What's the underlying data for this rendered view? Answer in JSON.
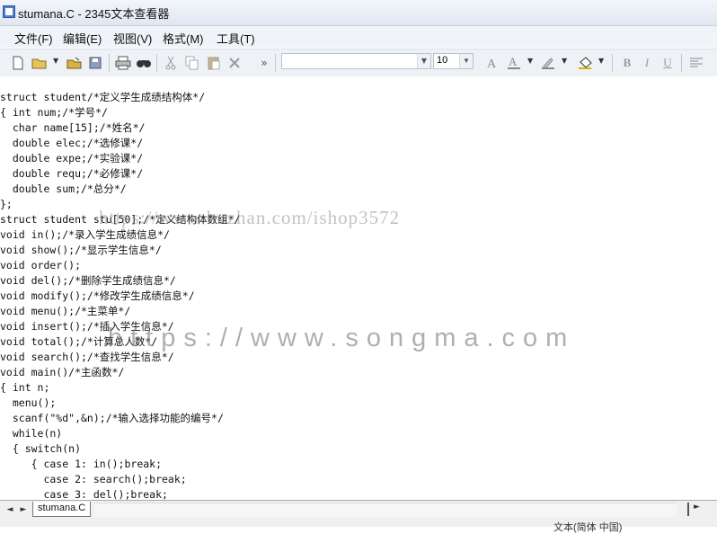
{
  "window": {
    "title": "stumana.C - 2345文本查看器"
  },
  "menu": [
    "文件(F)",
    "编辑(E)",
    "视图(V)",
    "格式(M)",
    "工具(T)"
  ],
  "toolbar": {
    "font_size": "10",
    "icons": [
      "new-file-icon",
      "open-folder-icon",
      "open-dropdown-icon",
      "open-recent-icon",
      "save-icon",
      "print-icon",
      "find-icon",
      "cut-icon",
      "copy-icon",
      "paste-icon",
      "delete-icon",
      "more-icon",
      "font-color-a-icon",
      "text-color-icon",
      "highlight-icon",
      "fill-icon",
      "bold-icon",
      "italic-icon",
      "underline-icon",
      "align-left-icon"
    ]
  },
  "code_lines": [
    "struct student/*定义学生成绩结构体*/",
    "{ int num;/*学号*/",
    "  char name[15];/*姓名*/",
    "  double elec;/*选修课*/",
    "  double expe;/*实验课*/",
    "  double requ;/*必修课*/",
    "  double sum;/*总分*/",
    "};",
    "struct student stu[50];/*定义结构体数组*/",
    "void in();/*录入学生成绩信息*/",
    "void show();/*显示学生信息*/",
    "void order();",
    "void del();/*删除学生成绩信息*/",
    "void modify();/*修改学生成绩信息*/",
    "void menu();/*主菜单*/",
    "void insert();/*插入学生信息*/",
    "void total();/*计算总人数*/",
    "void search();/*查找学生信息*/",
    "void main()/*主函数*/",
    "{ int n;",
    "  menu();",
    "  scanf(\"%d\",&n);/*输入选择功能的编号*/",
    "  while(n)",
    "  { switch(n)",
    "     { case 1: in();break;",
    "       case 2: search();break;",
    "       case 3: del();break;"
  ],
  "watermarks": [
    "https://www.huzhan.com/ishop3572",
    "https://www.songma.com"
  ],
  "status": {
    "tab": "stumana.C",
    "text": "文本(简体 中国)"
  }
}
